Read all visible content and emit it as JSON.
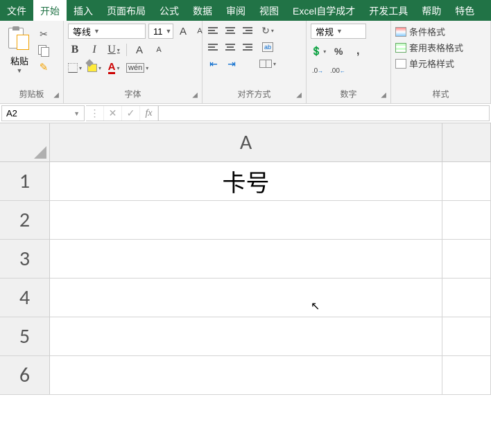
{
  "tabs": [
    "文件",
    "开始",
    "插入",
    "页面布局",
    "公式",
    "数据",
    "审阅",
    "视图",
    "Excel自学成才",
    "开发工具",
    "帮助",
    "特色"
  ],
  "activeTab": 1,
  "clipboard": {
    "paste": "粘贴",
    "label": "剪贴板"
  },
  "font": {
    "name": "等线",
    "size": "11",
    "label": "字体",
    "wen": "wén"
  },
  "align": {
    "label": "对齐方式",
    "wrap": "ab"
  },
  "number": {
    "format": "常规",
    "label": "数字"
  },
  "styles": {
    "cond": "条件格式",
    "table": "套用表格格式",
    "cell": "单元格样式",
    "label": "样式"
  },
  "namebox": "A2",
  "fx": "fx",
  "formula": "",
  "colA": "A",
  "rows": [
    "1",
    "2",
    "3",
    "4",
    "5",
    "6"
  ],
  "cellA1": "卡号"
}
